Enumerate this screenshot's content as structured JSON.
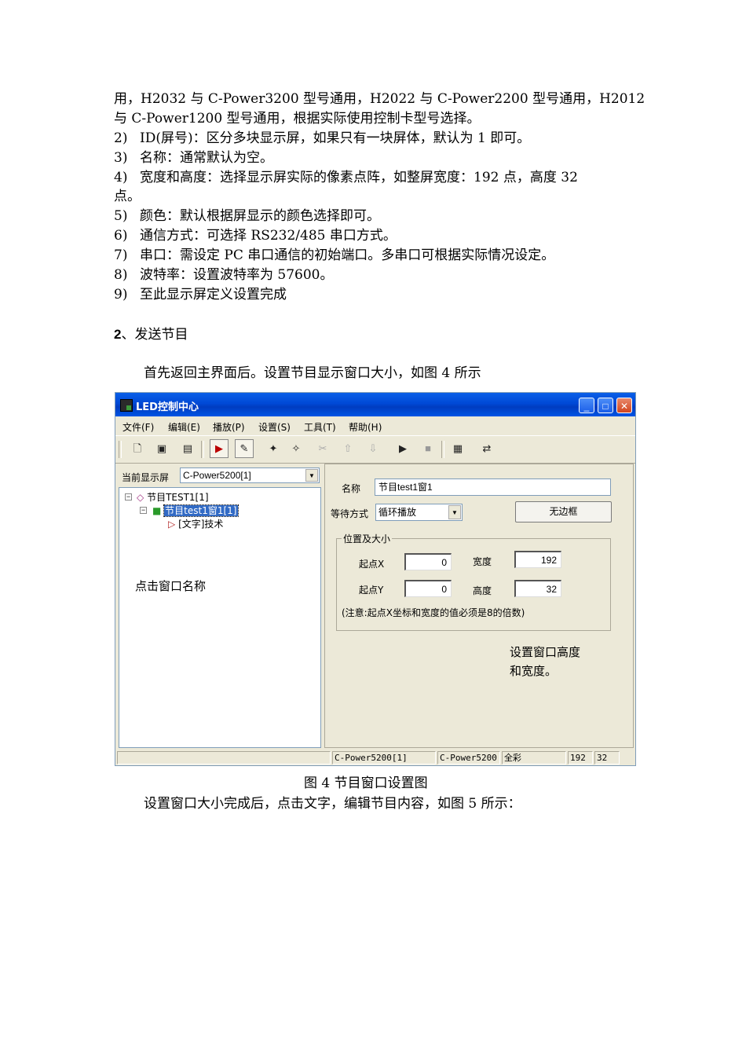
{
  "doc": {
    "lines": [
      "用，H2032 与 C-Power3200 型号通用，H2022 与 C-Power2200 型号通用，H2012",
      "与 C-Power1200 型号通用，根据实际使用控制卡型号选择。"
    ],
    "items": [
      {
        "num": "2)",
        "text": "ID(屏号)：区分多块显示屏，如果只有一块屏体，默认为 1 即可。"
      },
      {
        "num": "3)",
        "text": "名称：通常默认为空。"
      },
      {
        "num": "4)",
        "text": "宽度和高度：选择显示屏实际的像素点阵，如整屏宽度：192  点，高度  32"
      },
      {
        "cont": "点。"
      },
      {
        "num": "5)",
        "text": "颜色：默认根据屏显示的颜色选择即可。"
      },
      {
        "num": "6)",
        "text": "通信方式：可选择 RS232/485 串口方式。"
      },
      {
        "num": "7)",
        "text": "串口：需设定 PC 串口通信的初始端口。多串口可根据实际情况设定。"
      },
      {
        "num": "8)",
        "text": "波特率：设置波特率为 57600。"
      },
      {
        "num": "9)",
        "text": "至此显示屏定义设置完成"
      }
    ],
    "section_num": "2",
    "section_title": "、发送节目",
    "para1": "首先返回主界面后。设置节目显示窗口大小，如图 4 所示",
    "caption": "图  4 节目窗口设置图",
    "para2": "设置窗口大小完成后，点击文字，编辑节目内容，如图 5 所示："
  },
  "window": {
    "title": "LED控制中心",
    "menu": [
      "文件(F)",
      "编辑(E)",
      "播放(P)",
      "设置(S)",
      "工具(T)",
      "帮助(H)"
    ],
    "current_screen_label": "当前显示屏",
    "current_screen_value": "C-Power5200[1]",
    "tree": {
      "program": "节目TEST1[1]",
      "window": "节目test1窗1[1]",
      "text": "[文字]技术"
    },
    "note_left": "点击窗口名称",
    "name_label": "名称",
    "name_value": "节目test1窗1",
    "wait_label": "等待方式",
    "wait_value": "循环播放",
    "border_button": "无边框",
    "group_label": "位置及大小",
    "start_x_label": "起点X",
    "start_x_value": "0",
    "width_label": "宽度",
    "width_value": "192",
    "start_y_label": "起点Y",
    "start_y_value": "0",
    "height_label": "高度",
    "height_value": "32",
    "notice": "(注意:起点X坐标和宽度的值必须是8的倍数)",
    "note_right_1": "设置窗口高度",
    "note_right_2": "和宽度。",
    "status": [
      "C-Power5200[1]",
      "C-Power5200",
      "全彩",
      "192",
      "32"
    ]
  }
}
